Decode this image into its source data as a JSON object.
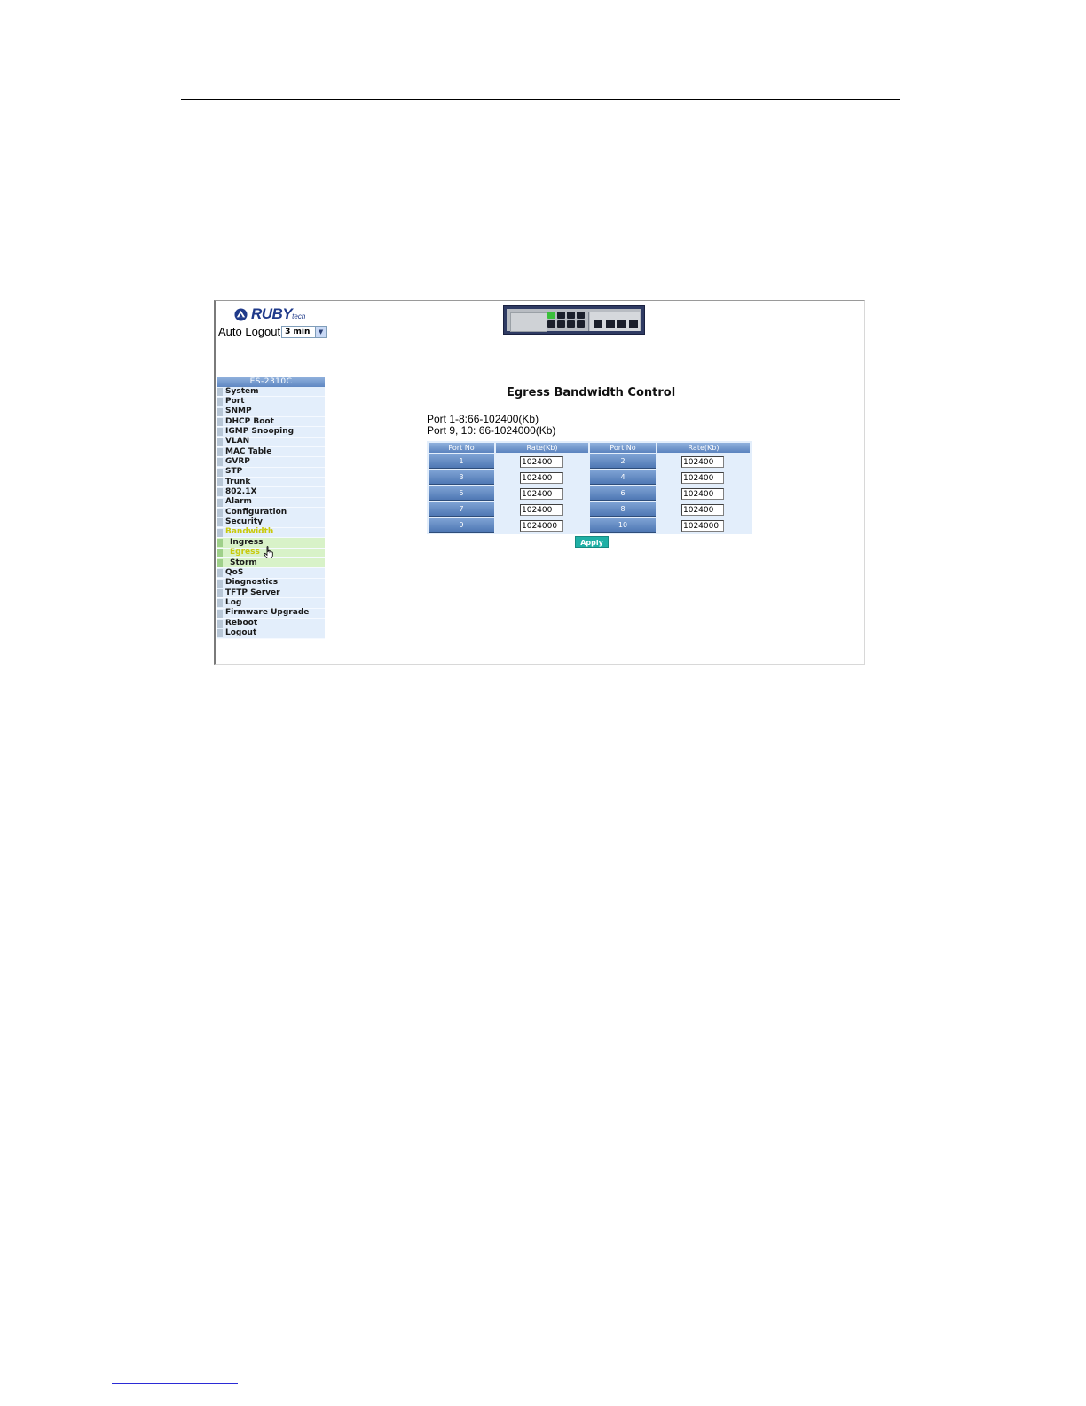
{
  "logo": {
    "text": "RUBY",
    "sub": "tech"
  },
  "auto_logout": {
    "label": "Auto Logout",
    "selected": "3 min"
  },
  "sidebar": {
    "header": "ES-2310C",
    "items": [
      {
        "label": "System"
      },
      {
        "label": "Port"
      },
      {
        "label": "SNMP"
      },
      {
        "label": "DHCP Boot"
      },
      {
        "label": "IGMP Snooping"
      },
      {
        "label": "VLAN"
      },
      {
        "label": "MAC Table"
      },
      {
        "label": "GVRP"
      },
      {
        "label": "STP"
      },
      {
        "label": "Trunk"
      },
      {
        "label": "802.1X"
      },
      {
        "label": "Alarm"
      },
      {
        "label": "Configuration"
      },
      {
        "label": "Security"
      },
      {
        "label": "Bandwidth"
      },
      {
        "label": "Ingress"
      },
      {
        "label": "Egress"
      },
      {
        "label": "Storm"
      },
      {
        "label": "QoS"
      },
      {
        "label": "Diagnostics"
      },
      {
        "label": "TFTP Server"
      },
      {
        "label": "Log"
      },
      {
        "label": "Firmware Upgrade"
      },
      {
        "label": "Reboot"
      },
      {
        "label": "Logout"
      }
    ]
  },
  "main": {
    "title": "Egress Bandwidth Control",
    "range_lines": [
      "Port 1-8:66-102400(Kb)",
      "Port 9, 10: 66-1024000(Kb)"
    ],
    "table": {
      "headers": [
        "Port No",
        "Rate(Kb)",
        "Port No",
        "Rate(Kb)"
      ],
      "rows": [
        {
          "port_a": "1",
          "rate_a": "102400",
          "port_b": "2",
          "rate_b": "102400"
        },
        {
          "port_a": "3",
          "rate_a": "102400",
          "port_b": "4",
          "rate_b": "102400"
        },
        {
          "port_a": "5",
          "rate_a": "102400",
          "port_b": "6",
          "rate_b": "102400"
        },
        {
          "port_a": "7",
          "rate_a": "102400",
          "port_b": "8",
          "rate_b": "102400"
        },
        {
          "port_a": "9",
          "rate_a": "1024000",
          "port_b": "10",
          "rate_b": "1024000"
        }
      ]
    },
    "apply_label": "Apply"
  },
  "colors": {
    "menu_bg": "#e3eefb",
    "header_blue": "#5f87c2",
    "active_yellow": "#c9c90b",
    "submenu_green": "#d8f2c8",
    "apply_teal": "#1fb0a5"
  },
  "icons": [
    "ruby-logo-icon",
    "chevron-down-icon",
    "hand-cursor-icon",
    "switch-device-icon"
  ]
}
